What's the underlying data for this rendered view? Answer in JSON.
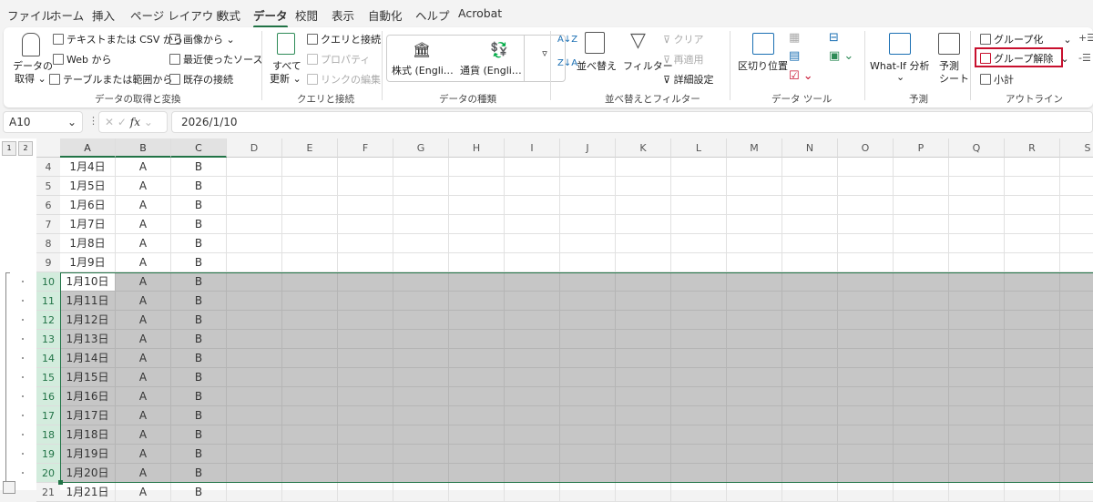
{
  "tabs": [
    "ファイル",
    "ホーム",
    "挿入",
    "ページ レイアウト",
    "数式",
    "データ",
    "校閲",
    "表示",
    "自動化",
    "ヘルプ",
    "Acrobat"
  ],
  "ribbon": {
    "get_data": "データの\n取得",
    "get_data_line1": "データの",
    "get_data_line2": "取得 ⌄",
    "from_text_csv": "テキストまたは CSV から",
    "from_web": "Web から",
    "from_table": "テーブルまたは範囲から",
    "from_picture": "画像から ⌄",
    "recent_sources": "最近使ったソース",
    "existing_connections": "既存の接続",
    "group_get": "データの取得と変換",
    "refresh_line1": "すべて",
    "refresh_line2": "更新 ⌄",
    "queries_connections": "クエリと接続",
    "properties": "プロパティ",
    "edit_links": "リンクの編集",
    "group_queries": "クエリと接続",
    "stocks": "株式 (Engli…",
    "currencies": "通貨 (Engli…",
    "group_types": "データの種類",
    "sort": "並べ替え",
    "filter": "フィルター",
    "clear": "クリア",
    "reapply": "再適用",
    "advanced": "詳細設定",
    "group_sort": "並べ替えとフィルター",
    "text_to_columns": "区切り位置",
    "group_tools": "データ ツール",
    "whatif": "What-If 分析",
    "whatif_caret": "⌄",
    "forecast_line1": "予測",
    "forecast_line2": "シート",
    "group_forecast": "予測",
    "group": "グループ化",
    "ungroup": "グループ解除",
    "subtotal": "小計",
    "group_outline": "アウトライン",
    "highlight_color": "#c8102e"
  },
  "formula_bar": {
    "name_box": "A10",
    "fx": "fx",
    "value": "2026/1/10"
  },
  "outline_levels": [
    "1",
    "2"
  ],
  "columns": [
    "A",
    "B",
    "C",
    "D",
    "E",
    "F",
    "G",
    "H",
    "I",
    "J",
    "K",
    "L",
    "M",
    "N",
    "O",
    "P",
    "Q",
    "R",
    "S"
  ],
  "rows": [
    {
      "n": "4",
      "a": "1月4日",
      "b": "A",
      "c": "B"
    },
    {
      "n": "5",
      "a": "1月5日",
      "b": "A",
      "c": "B"
    },
    {
      "n": "6",
      "a": "1月6日",
      "b": "A",
      "c": "B"
    },
    {
      "n": "7",
      "a": "1月7日",
      "b": "A",
      "c": "B"
    },
    {
      "n": "8",
      "a": "1月8日",
      "b": "A",
      "c": "B"
    },
    {
      "n": "9",
      "a": "1月9日",
      "b": "A",
      "c": "B"
    },
    {
      "n": "10",
      "a": "1月10日",
      "b": "A",
      "c": "B"
    },
    {
      "n": "11",
      "a": "1月11日",
      "b": "A",
      "c": "B"
    },
    {
      "n": "12",
      "a": "1月12日",
      "b": "A",
      "c": "B"
    },
    {
      "n": "13",
      "a": "1月13日",
      "b": "A",
      "c": "B"
    },
    {
      "n": "14",
      "a": "1月14日",
      "b": "A",
      "c": "B"
    },
    {
      "n": "15",
      "a": "1月15日",
      "b": "A",
      "c": "B"
    },
    {
      "n": "16",
      "a": "1月16日",
      "b": "A",
      "c": "B"
    },
    {
      "n": "17",
      "a": "1月17日",
      "b": "A",
      "c": "B"
    },
    {
      "n": "18",
      "a": "1月18日",
      "b": "A",
      "c": "B"
    },
    {
      "n": "19",
      "a": "1月19日",
      "b": "A",
      "c": "B"
    },
    {
      "n": "20",
      "a": "1月20日",
      "b": "A",
      "c": "B"
    },
    {
      "n": "21",
      "a": "1月21日",
      "b": "A",
      "c": "B"
    }
  ],
  "selection": {
    "first_row": "10",
    "last_row": "20",
    "active": "A10"
  }
}
